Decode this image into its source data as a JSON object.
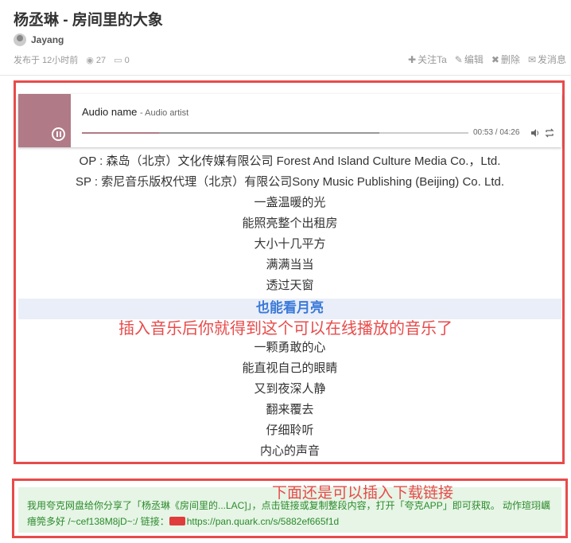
{
  "post": {
    "title": "杨丞琳 - 房间里的大象",
    "author": "Jayang",
    "posted": "发布于 12小时前",
    "views": "27",
    "comments": "0"
  },
  "actions": {
    "follow": "关注Ta",
    "edit": "编辑",
    "delete": "删除",
    "message": "发消息"
  },
  "player": {
    "name": "Audio name",
    "artist": "- Audio artist",
    "time": "00:53 / 04:26",
    "progress_played": 0.2,
    "progress_loaded": 0.77,
    "accent_color": "#b07a86"
  },
  "lyrics": [
    "OP : 森岛（北京）文化传媒有限公司 Forest And Island Culture Media Co.，Ltd.",
    "SP : 索尼音乐版权代理（北京）有限公司Sony Music Publishing (Beijing) Co. Ltd.",
    "一盏温暖的光",
    "能照亮整个出租房",
    "大小十几平方",
    "满满当当",
    "透过天窗",
    "也能看月亮",
    "一颗勇敢的心",
    "能直视自己的眼睛",
    "又到夜深人静",
    "翻来覆去",
    "仔细聆听",
    "内心的声音"
  ],
  "annotations": {
    "top": "插入音乐后你就得到这个可以在线播放的音乐了",
    "bottom": "下面还是可以插入下载链接"
  },
  "share": {
    "text": "我用夸克网盘给你分享了「杨丞琳《房间里的...LAC]」，点击链接或复制整段内容，打开「夸克APP」即可获取。 动作瑄珝巁瘖筦多好 /~cef138M8jD~:/ 链接：",
    "link": "https://pan.quark.cn/s/5882ef665f1d"
  }
}
